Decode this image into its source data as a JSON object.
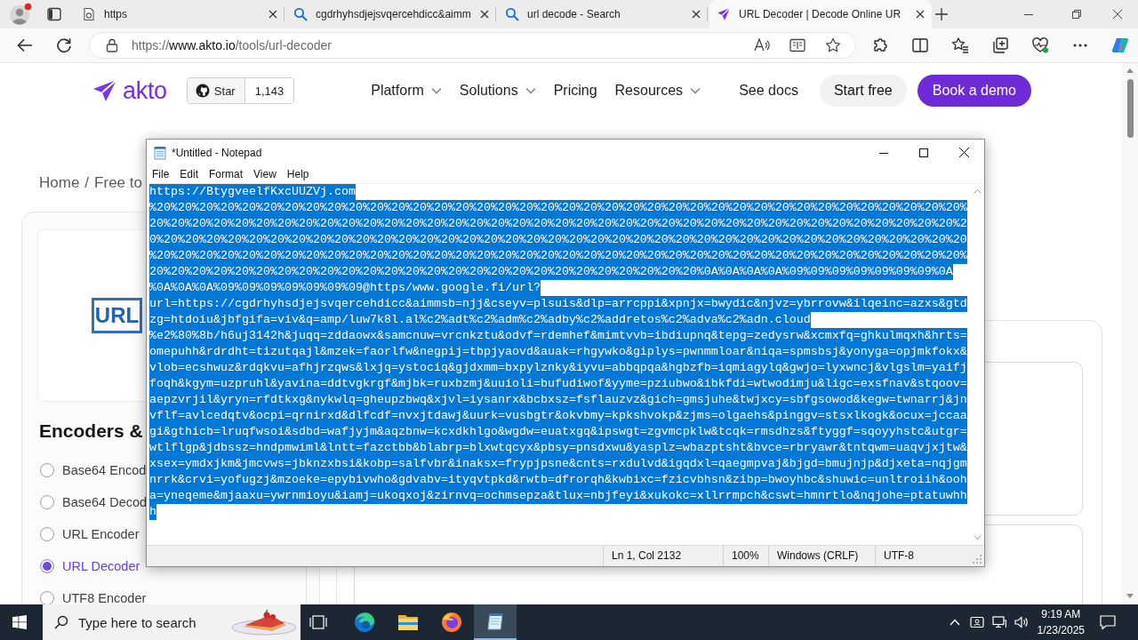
{
  "browser": {
    "tabs": [
      {
        "kind": "page",
        "title": "https",
        "selected": false
      },
      {
        "kind": "search",
        "title": "cgdrhyhsdjejsvqercehdicc&aimm",
        "selected": false
      },
      {
        "kind": "search",
        "title": "url decode - Search",
        "selected": false
      },
      {
        "kind": "site",
        "title": "URL Decoder | Decode Online UR",
        "selected": true
      }
    ],
    "address": {
      "scheme": "https://",
      "host": "www.akto.io",
      "path": "/tools/url-decoder"
    }
  },
  "site": {
    "logo": "akto",
    "github": {
      "label": "Star",
      "count": "1,143"
    },
    "nav": [
      {
        "label": "Platform",
        "dropdown": true
      },
      {
        "label": "Solutions",
        "dropdown": true
      },
      {
        "label": "Pricing",
        "dropdown": false
      },
      {
        "label": "Resources",
        "dropdown": true
      }
    ],
    "docs_link": "See docs",
    "buttons": [
      {
        "kind": "secondary",
        "label": "Start free"
      },
      {
        "kind": "primary",
        "label": "Book a demo"
      }
    ],
    "breadcrumb": {
      "items": [
        "Home",
        "Free to"
      ],
      "separator": "/"
    },
    "tool_logo": "URL",
    "section_title": "Encoders &",
    "tools": [
      {
        "label": "Base64 Encod",
        "selected": false
      },
      {
        "label": "Base64 Decod",
        "selected": false
      },
      {
        "label": "URL Encoder",
        "selected": false
      },
      {
        "label": "URL Decoder",
        "selected": true
      },
      {
        "label": "UTF8 Encoder",
        "selected": false
      }
    ]
  },
  "notepad": {
    "title": "*Untitled - Notepad",
    "menu": [
      "File",
      "Edit",
      "Format",
      "View",
      "Help"
    ],
    "text_selected": true,
    "lines": [
      "https://BtygveelfKxcUUZVj.com",
      "%20%20%20%20%20%20%20%20%20%20%20%20%20%20%20%20%20%20%20%20%20%20%20%20%20%20%20%20%20%20%20%20%20%20%20%20%20%20%",
      "20%20%20%20%20%20%20%20%20%20%20%20%20%20%20%20%20%20%20%20%20%20%20%20%20%20%20%20%20%20%20%20%20%20%20%20%20%20%2",
      "0%20%20%20%20%20%20%20%20%20%20%20%20%20%20%20%20%20%20%20%20%20%20%20%20%20%20%20%20%20%20%20%20%20%20%20%20%20%20",
      "%20%20%20%20%20%20%20%20%20%20%20%20%20%20%20%20%20%20%20%20%20%20%20%20%20%20%20%20%20%20%20%20%20%20%20%20%20%20%",
      "20%20%20%20%20%20%20%20%20%20%20%20%20%20%20%20%20%20%20%20%20%20%20%20%20%20%0A%0A%0A%0A%09%09%09%09%09%09%09%0A",
      "%0A%0A%0A%09%09%09%09%09%09%09@https/www.google.fi/url?",
      "url=https://cgdrhyhsdjejsvqercehdicc&aimmsb=njj&cseyv=plsuis&dlp=arrcppi&xpnjx=bwydic&njvz=ybrrovw&ilqeinc=azxs&gtd",
      "zg=htdoiu&jbfgifa=viv&q=amp/luw7k8l.al%c2%adt%c2%adm%c2%adby%c2%addretos%c2%adva%c2%adn.cloud",
      "%e2%80%8b/h6uj3142h&juqq=zddaowx&samcnuw=vrcnkztu&odvf=rdemhef&mimtvvb=ibdiupnq&tepg=zedysrw&xcmxfq=ghkulmqxh&hrts=",
      "omepuhh&rdrdht=tizutqajl&mzek=faorlfw&negpij=tbpjyaovd&auak=rhgywko&giplys=pwnmmloar&niqa=spmsbsj&yonyga=opjmkfokx&",
      "vlob=ecshwuz&rdqkvu=afhjrzqws&lxjq=ystociq&gjdxmm=bxpylznky&iyvu=abbqpqa&hgbzfb=iqmiagylq&gwjo=lyxwncj&vlgslm=yaifj",
      "foqh&kgym=uzpruhl&yavina=ddtvgkrgf&mjbk=ruxbzmj&uuioli=bufudiwof&yyme=pziubwo&ibkfdi=wtwodimju&ligc=exsfnav&stqoov=",
      "aepzvrjil&yryn=rfdtkxg&nykwlq=gheupzbwq&xjvl=iysanrx&bcbxsz=fsflauzvz&gich=gmsjuhe&twjxcy=sbfgsowod&kegw=twnarrj&jn",
      "vflf=avlcedqtv&ocpi=qrnirxd&dlfcdf=nvxjtdawj&uurk=vusbgtr&okvbmy=kpkshvokp&zjms=olgaehs&pinggv=stsxlkogk&ocux=jccaa",
      "gi&gthicb=lruqfwsoi&sdbd=wafjyjm&aqzbnw=kcxdkhlgo&wgdw=euatxgq&ipswgt=zgvmcpklw&tcqk=rmsdhzs&ftyggf=sqoyyhstc&utgr=",
      "wtlflgp&jdbssz=hndpmwiml&lntt=fazctbb&blabrp=blxwtqcyx&pbsy=pnsdxwu&yasplz=wbazptsht&bvce=rbryawr&tntqwm=uaqvjxjtw&",
      "xsex=ymdxjkm&jmcvws=jbknzxbsi&kobp=salfvbr&inaksx=frypjpsne&cnts=rxdulvd&igqdxl=qaegmpvaj&bjgd=bmujnjp&djxeta=nqjgm",
      "nrrk&crvi=yofugzj&mzoeke=epybivwho&gdvabv=ityqvtpkd&rwtb=dfrorqh&kwbixc=fzicvbhsn&zibp=bwoyhbc&shuwic=unltroiih&ooh",
      "a=yneqeme&mjaaxu=ywrnmioyu&iamj=ukoqxoj&zirnvq=ochmsepza&tlux=nbjfeyi&xukokc=xllrrmpch&cswt=hmnrtlo&nqjohe=ptatuwhh",
      "h"
    ],
    "status": [
      "Ln 1, Col 2132",
      "100%",
      "Windows (CRLF)",
      "UTF-8"
    ]
  },
  "taskbar": {
    "search_placeholder": "Type here to search",
    "apps": [
      {
        "kind": "task-view",
        "selected": false
      },
      {
        "kind": "edge",
        "selected": false
      },
      {
        "kind": "explorer",
        "selected": false
      },
      {
        "kind": "firefox",
        "selected": false
      },
      {
        "kind": "notepad",
        "selected": true
      }
    ],
    "time": "9:19 AM",
    "date": "1/23/2025"
  }
}
